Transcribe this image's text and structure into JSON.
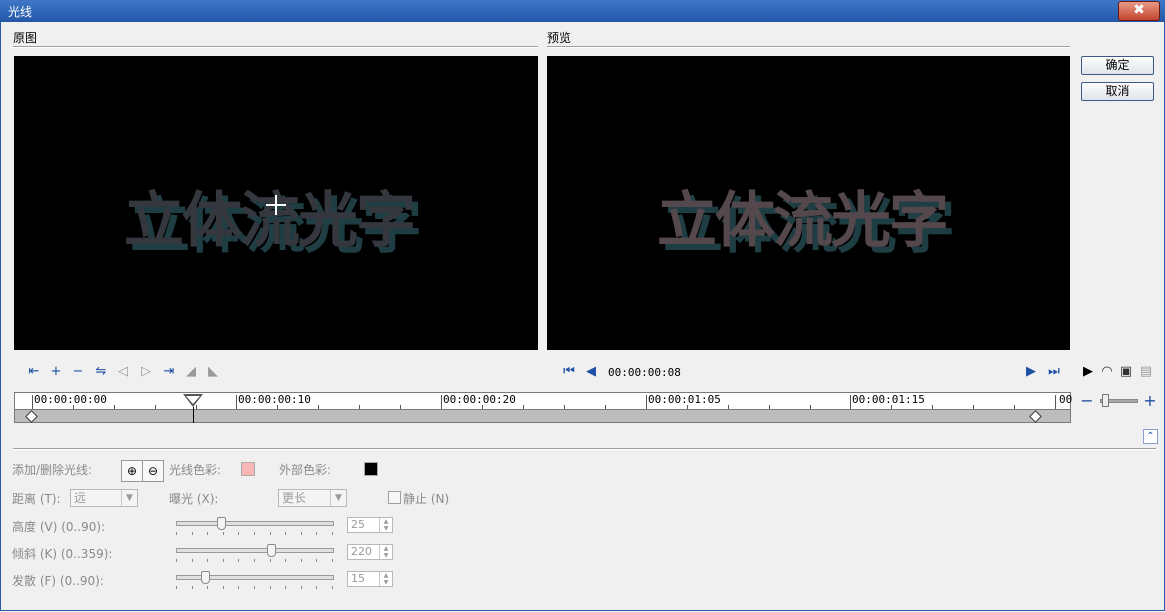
{
  "window": {
    "title": "光线",
    "close_label": "✖"
  },
  "original": {
    "label": "原图",
    "image_text": "立体流光字"
  },
  "preview": {
    "label": "预览",
    "image_text": "立体流光字",
    "timecode": "00:00:00:08"
  },
  "buttons": {
    "ok": "确定",
    "cancel": "取消"
  },
  "timeline": {
    "marks": [
      "00:00:00:00",
      "00:00:00:10",
      "00:00:00:20",
      "00:00:01:05",
      "00:00:01:15",
      "00"
    ],
    "zoom_out": "−",
    "zoom_in": "+",
    "collapse": "⌃"
  },
  "light": {
    "add_remove_label": "添加/删除光线:",
    "color_label": "光线色彩:",
    "color": "#f8b8b8",
    "outer_color_label": "外部色彩:",
    "outer_color": "#000000"
  },
  "distance": {
    "label": "距离 (T):",
    "value": "远"
  },
  "exposure": {
    "label": "曝光 (X):",
    "value": "更长"
  },
  "still": {
    "label": "静止 (N)",
    "checked": false
  },
  "height": {
    "label": "高度 (V) (0..90):",
    "value": "25",
    "level": 25,
    "max": 90
  },
  "tilt": {
    "label": "倾斜 (K) (0..359):",
    "value": "220",
    "level": 220,
    "max": 359
  },
  "diffuse": {
    "label": "发散 (F) (0..90):",
    "value": "15",
    "level": 15,
    "max": 90
  }
}
